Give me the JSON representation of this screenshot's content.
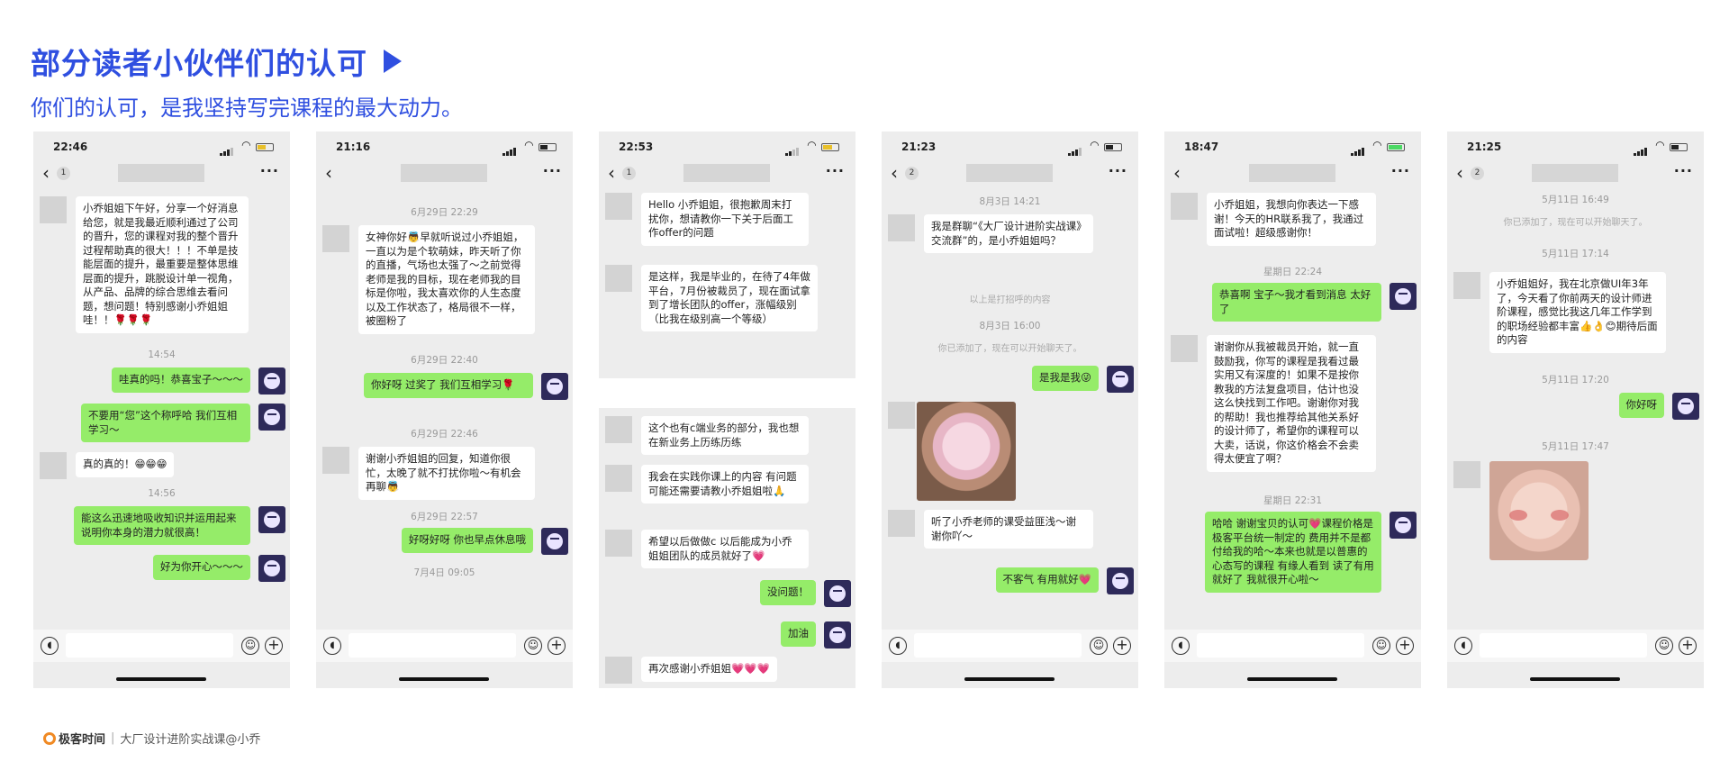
{
  "header": {
    "title": "部分读者小伙伴们的认可",
    "subtitle": "你们的认可，是我坚持写完课程的最大动力。"
  },
  "footer": {
    "brand": "极客时间",
    "separator": "|",
    "course": "大厂设计进阶实战课@小乔"
  },
  "phones": [
    {
      "time": "22:46",
      "unread": "1",
      "messages": [
        {
          "side": "left",
          "text": "小乔姐姐下午好，分享一个好消息给您，就是我最近顺利通过了公司的晋升，您的课程对我的整个晋升过程帮助真的很大！！！不单是技能层面的提升，最重要是整体思维层面的提升，跳脱设计单一视角，从产品、品牌的综合思维去看问题，想问题！特别感谢小乔姐姐哇！！🌹🌹🌹"
        },
        {
          "ts": "14:54"
        },
        {
          "side": "right",
          "text": "哇真的吗！恭喜宝子～～～"
        },
        {
          "side": "right",
          "text": "不要用“您”这个称呼哈 我们互相学习～"
        },
        {
          "side": "left",
          "text": "真的真的！😁😁😁"
        },
        {
          "ts": "14:56"
        },
        {
          "side": "right",
          "text": "能这么迅速地吸收知识并运用起来 说明你本身的潜力就很高！"
        },
        {
          "side": "right",
          "text": "好为你开心～～～"
        }
      ]
    },
    {
      "time": "21:16",
      "unread": "",
      "messages": [
        {
          "ts": "6月29日 22:29"
        },
        {
          "side": "left",
          "text": "女神你好👼早就听说过小乔姐姐，一直以为是个软萌妹，昨天听了你的直播，气场也太强了～之前觉得老师是我的目标，现在老师我的目标是你啦，我太喜欢你的人生态度以及工作状态了，格局很不一样，被圈粉了"
        },
        {
          "ts": "6月29日 22:40"
        },
        {
          "side": "right",
          "text": "你好呀 过奖了 我们互相学习🌹"
        },
        {
          "ts": "6月29日 22:46"
        },
        {
          "side": "left",
          "text": "谢谢小乔姐姐的回复，知道你很忙，太晚了就不打扰你啦～有机会再聊👼"
        },
        {
          "ts": "6月29日 22:57"
        },
        {
          "side": "right",
          "text": "好呀好呀 你也早点休息哦"
        },
        {
          "ts": "7月4日 09:05"
        }
      ]
    },
    {
      "time": "22:53",
      "unread": "1",
      "messages": [
        {
          "side": "left",
          "text": "Hello 小乔姐姐，很抱歉周末打扰你，想请教你一下关于后面工作offer的问题"
        },
        {
          "side": "left",
          "text": "是这样，我是毕业的，在待了4年做平台，7月份被裁员了，现在面试拿到了增长团队的offer，涨幅级别（比我在级别高一个等级）"
        },
        {
          "side": "left",
          "text": "这个也有c端业务的部分，我也想在新业务上历练历练"
        },
        {
          "side": "left",
          "text": "我会在实践你课上的内容 有问题可能还需要请教小乔姐姐啦🙏"
        },
        {
          "side": "left",
          "text": "希望以后做做c 以后能成为小乔姐姐团队的成员就好了💗"
        },
        {
          "side": "right",
          "text": "没问题！"
        },
        {
          "side": "right",
          "text": "加油"
        },
        {
          "side": "left",
          "text": "再次感谢小乔姐姐💗💗💗"
        }
      ]
    },
    {
      "time": "21:23",
      "unread": "2",
      "messages": [
        {
          "ts": "8月3日 14:21"
        },
        {
          "side": "left",
          "text": "我是群聊“《大厂设计进阶实战课》交流群”的，是小乔姐姐吗？"
        },
        {
          "sys": "以上是打招呼的内容"
        },
        {
          "ts": "8月3日 16:00"
        },
        {
          "sys": "你已添加了，现在可以开始聊天了。"
        },
        {
          "side": "right",
          "text": "是我是我😜"
        },
        {
          "side": "left",
          "image": "cat-plush-image"
        },
        {
          "side": "left",
          "text": "听了小乔老师的课受益匪浅～谢谢你吖～"
        },
        {
          "side": "right",
          "text": "不客气 有用就好💗"
        }
      ]
    },
    {
      "time": "18:47",
      "unread": "",
      "messages": [
        {
          "side": "left",
          "text": "小乔姐姐，我想向你表达一下感谢！今天的HR联系我了，我通过面试啦！超级感谢你！"
        },
        {
          "ts": "星期日 22:24"
        },
        {
          "side": "right",
          "text": "恭喜啊 宝子～我才看到消息 太好了"
        },
        {
          "side": "left",
          "text": "谢谢你从我被裁员开始，就一直鼓励我，你写的课程是我看过最实用又有深度的！如果不是按你教我的方法复盘项目，估计也没这么快找到工作吧。谢谢你对我的帮助！我也推荐给其他关系好的设计师了，希望你的课程可以大卖，话说，你这价格会不会卖得太便宜了啊？"
        },
        {
          "ts": "星期日 22:31"
        },
        {
          "side": "right",
          "text": "哈哈 谢谢宝贝的认可💗课程价格是极客平台统一制定的 费用并不是都付给我的哈～本来也就是以普惠的心态写的课程 有缘人看到 读了有用就好了 我就很开心啦～"
        }
      ]
    },
    {
      "time": "21:25",
      "unread": "2",
      "messages": [
        {
          "ts": "5月11日 16:49"
        },
        {
          "sys": "你已添加了，现在可以开始聊天了。"
        },
        {
          "ts": "5月11日 17:14"
        },
        {
          "side": "left",
          "text": "小乔姐姐好，我在北京做UI年3年了，今天看了你前两天的设计师进阶课程，感觉比我这几年工作学到的职场经验都丰富👍👌😊期待后面的内容"
        },
        {
          "ts": "5月11日 17:20"
        },
        {
          "side": "right",
          "text": "你好呀"
        },
        {
          "ts": "5月11日 17:47"
        },
        {
          "side": "left",
          "image": "baby-photo-image"
        }
      ]
    }
  ]
}
